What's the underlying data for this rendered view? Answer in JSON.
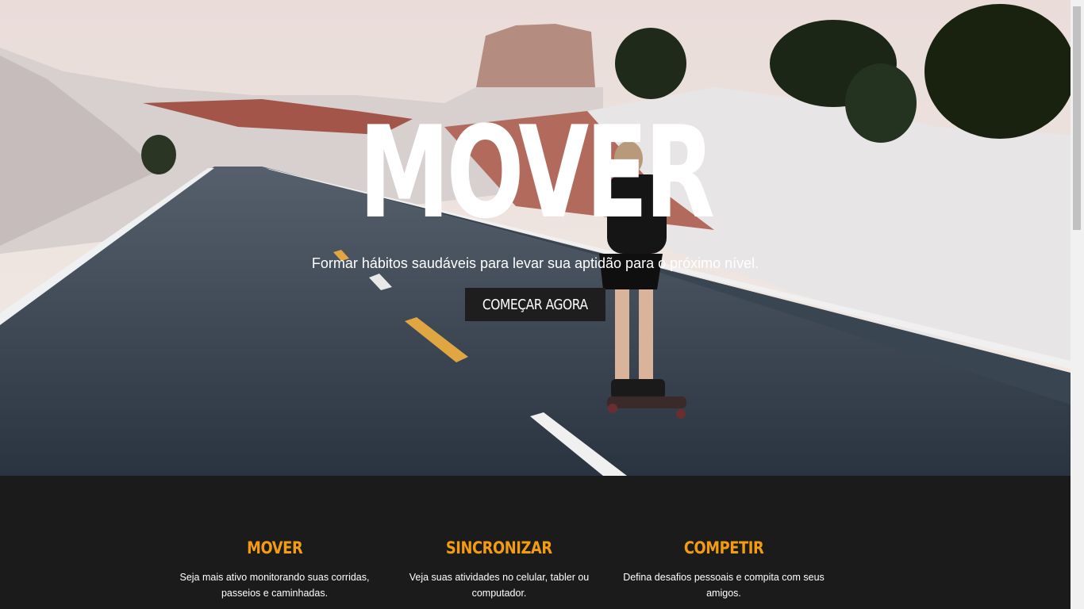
{
  "hero": {
    "title": "MOVER",
    "subtitle": "Formar hábitos saudáveis para levar sua aptidão para o próximo nível.",
    "cta_label": "COMEÇAR AGORA"
  },
  "features": [
    {
      "title": "MOVER",
      "text": "Seja mais ativo monitorando suas corridas, passeios e caminhadas."
    },
    {
      "title": "SINCRONIZAR",
      "text": "Veja suas atividades no celular, tabler ou computador."
    },
    {
      "title": "COMPETIR",
      "text": "Defina desafios pessoais e compita com seus amigos."
    }
  ],
  "colors": {
    "accent": "#f39c12",
    "dark": "#1b1b1b"
  }
}
